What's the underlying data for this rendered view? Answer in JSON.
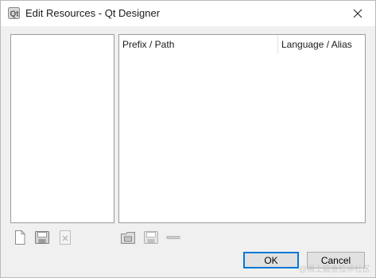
{
  "window": {
    "title": "Edit Resources - Qt Designer"
  },
  "icons": {
    "app": "qt-designer-icon",
    "close": "close-icon",
    "new_file": "new-file-icon",
    "open_file": "open-file-icon",
    "remove_file": "remove-file-icon",
    "add_prefix": "add-prefix-icon",
    "add_files": "add-files-icon",
    "remove": "remove-icon"
  },
  "resources_table": {
    "columns": [
      "Prefix / Path",
      "Language / Alias"
    ]
  },
  "buttons": {
    "ok": "OK",
    "cancel": "Cancel"
  },
  "watermark": {
    "text": "@稀土掘金技术社区"
  }
}
